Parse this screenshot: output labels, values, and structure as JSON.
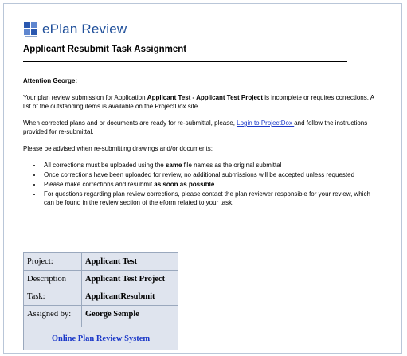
{
  "header": {
    "brand": "ePlan Review",
    "subtitle": "Applicant Resubmit Task Assignment"
  },
  "body": {
    "greeting": "Attention George:",
    "p1_a": "Your plan review submission for Application ",
    "p1_b": "Applicant Test - Applicant Test Project",
    "p1_c": " is incomplete or requires corrections. A list of the outstanding items is available on the ProjectDox site.",
    "p2_a": "When corrected plans and or documents are ready for re-submittal, please, ",
    "p2_link": "Login to ProjectDox ",
    "p2_b": "and follow the instructions provided for re-submittal.",
    "p3": "Please be advised when re-submitting drawings and/or documents:",
    "bullets": {
      "b1_a": "All corrections must be uploaded using the ",
      "b1_b": "same",
      "b1_c": " file names as the original submittal",
      "b2": "Once corrections have been uploaded for review, no additional submissions will be accepted unless requested",
      "b3_a": "Please make corrections and resubmit ",
      "b3_b": "as soon as possible",
      "b4": "For questions regarding plan review corrections, please contact the plan reviewer responsible for your review, which can be found in the review section of the eform related to your task."
    }
  },
  "table": {
    "rows": [
      {
        "label": "Project:",
        "value": "Applicant Test"
      },
      {
        "label": "Description",
        "value": "Applicant Test Project"
      },
      {
        "label": "Task:",
        "value": "ApplicantResubmit"
      },
      {
        "label": "Assigned by:",
        "value": "George Semple"
      }
    ],
    "link_label": "Online Plan Review System"
  },
  "colors": {
    "brand": "#1f4f9a",
    "link": "#1a37c8",
    "table_bg": "#dfe4ee"
  }
}
